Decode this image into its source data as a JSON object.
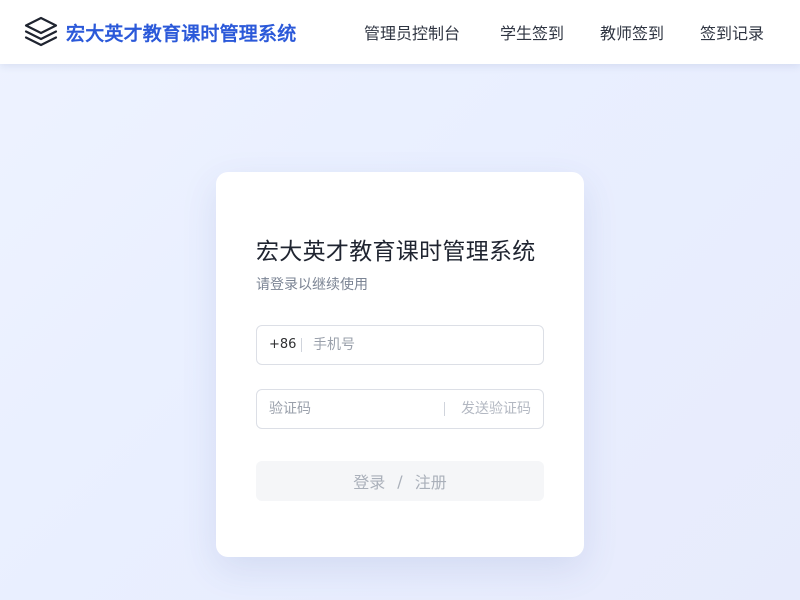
{
  "header": {
    "logo_icon": "layers-stack-icon",
    "title": "宏大英才教育课时管理系统",
    "brand_color": "#2b59d9",
    "nav": [
      {
        "label": "管理员控制台"
      },
      {
        "label": "学生签到"
      },
      {
        "label": "教师签到"
      },
      {
        "label": "签到记录"
      }
    ]
  },
  "login": {
    "title": "宏大英才教育课时管理系统",
    "subtitle": "请登录以继续使用",
    "phone": {
      "prefix": "+86",
      "placeholder": "手机号",
      "value": ""
    },
    "code": {
      "placeholder": "验证码",
      "value": "",
      "send_label": "发送验证码"
    },
    "submit": {
      "login_label": "登录",
      "separator": "/",
      "register_label": "注册",
      "disabled": true
    }
  }
}
